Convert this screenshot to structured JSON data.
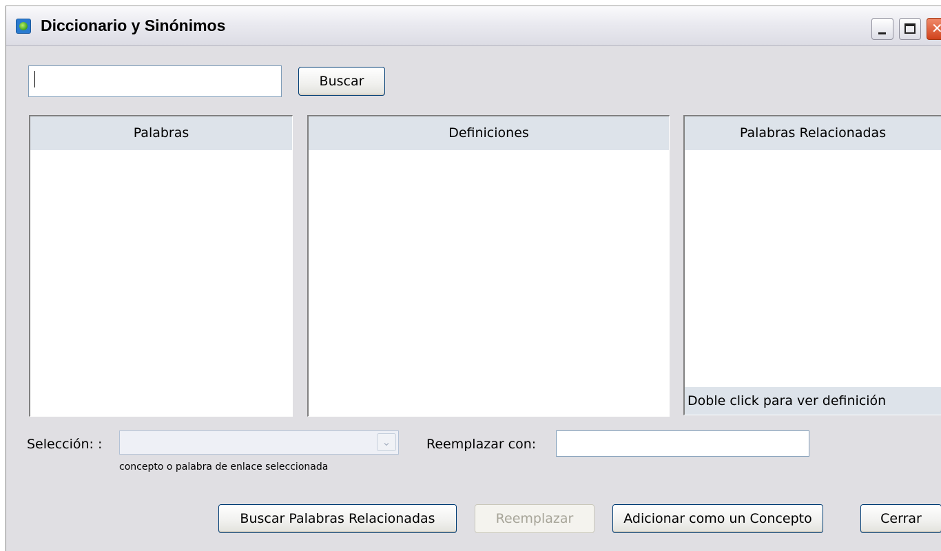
{
  "window": {
    "title": "Diccionario y Sinónimos"
  },
  "search": {
    "value": "",
    "button_label": "Buscar"
  },
  "panels": {
    "words": {
      "header": "Palabras"
    },
    "definitions": {
      "header": "Definiciones"
    },
    "related": {
      "header": "Palabras Relacionadas",
      "footer": "Doble click para ver definición"
    }
  },
  "selection": {
    "label": "Selección: :",
    "value": "",
    "hint": "concepto o palabra de  enlace seleccionada"
  },
  "replace": {
    "label": "Reemplazar con:",
    "value": ""
  },
  "buttons": {
    "find_related": "Buscar Palabras Relacionadas",
    "replace": "Reemplazar",
    "add_concept": "Adicionar como un Concepto",
    "close": "Cerrar"
  },
  "icons": {
    "app": "dictionary-app-icon",
    "minimize": "minimize-icon",
    "maximize": "maximize-icon",
    "close": "close-icon",
    "dropdown": "chevron-down-icon"
  },
  "colors": {
    "window_bg": "#e0dfe3",
    "panel_header_bg": "#dde3ea",
    "button_border": "#003c74",
    "close_button": "#d0421c"
  }
}
